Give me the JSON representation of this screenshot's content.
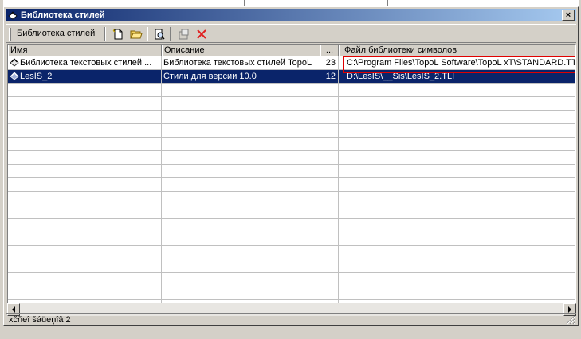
{
  "window": {
    "title": "Библиотека стилей",
    "close_label": "×"
  },
  "toolbar": {
    "label": "Библиотека стилей",
    "buttons": [
      {
        "icon": "new-document-icon"
      },
      {
        "icon": "open-folder-icon"
      },
      {
        "icon": "preview-icon"
      },
      {
        "icon": "properties-icon"
      },
      {
        "icon": "delete-icon"
      }
    ]
  },
  "table": {
    "columns": [
      "Имя",
      "Описание",
      "...",
      "Файл библиотеки символов"
    ],
    "rows": [
      {
        "name": "Библиотека текстовых стилей ...",
        "description": "Библиотека текстовых стилей TopoL",
        "count": "23",
        "file": "C:\\Program Files\\TopoL Software\\TopoL xT\\STANDARD.TTS",
        "selected": false
      },
      {
        "name": "LesIS_2",
        "description": "Стили для версии 10.0",
        "count": "12",
        "file": "D:\\LesIS\\__Sis\\LesIS_2.TLI",
        "selected": true
      }
    ]
  },
  "statusbar": {
    "text": "xčňeî šáüeņîâ 2"
  },
  "colors": {
    "selection": "#0a246a",
    "highlight_box": "#e00000",
    "title_gradient_start": "#0a246a",
    "title_gradient_end": "#a6caf0"
  }
}
